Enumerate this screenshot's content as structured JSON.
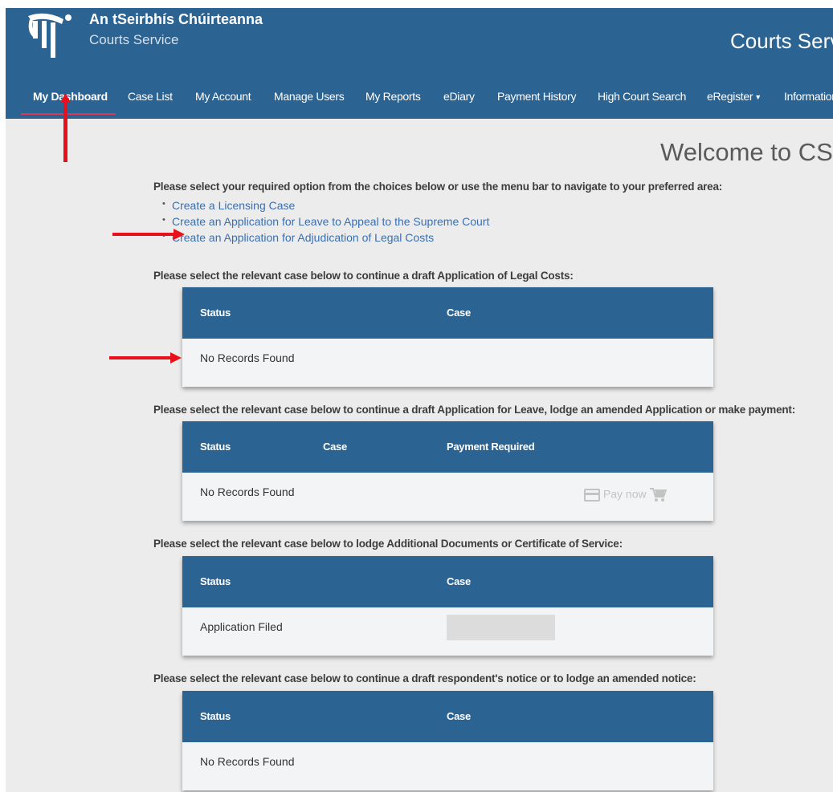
{
  "header": {
    "brand_title": "An tSeirbhís Chúirteanna",
    "brand_subtitle": "Courts Service",
    "right_title": "Courts Servi",
    "bg_color": "#2b6393",
    "logo_icon": "courts-harp-logo"
  },
  "nav": {
    "items": [
      {
        "label": "My Dashboard",
        "active": true
      },
      {
        "label": "Case List"
      },
      {
        "label": "My Account"
      },
      {
        "label": "Manage Users"
      },
      {
        "label": "My Reports"
      },
      {
        "label": "eDiary"
      },
      {
        "label": "Payment History"
      },
      {
        "label": "High Court Search"
      },
      {
        "label": "eRegister",
        "dropdown": true
      },
      {
        "label": "Information",
        "dropdown": true
      }
    ],
    "active_underline_color": "#d8385a"
  },
  "main": {
    "welcome": "Welcome to CSC",
    "intro": "Please select your required option from the choices below or use the menu bar to navigate to your preferred area:",
    "links": [
      "Create a Licensing Case",
      "Create an Application for Leave to Appeal to the Supreme Court",
      "Create an Application for Adjudication of Legal Costs"
    ],
    "sections": [
      {
        "label": "Please select the relevant case below to continue a draft Application of Legal Costs:",
        "headers": [
          "Status",
          "Case"
        ],
        "row": {
          "status": "No Records Found"
        }
      },
      {
        "label": "Please select the relevant case below to continue a draft Application for Leave, lodge an amended Application or make payment:",
        "headers": [
          "Status",
          "Case",
          "Payment Required"
        ],
        "row": {
          "status": "No Records Found",
          "pay_label": "Pay now"
        }
      },
      {
        "label": "Please select the relevant case below to lodge Additional Documents or Certificate of Service:",
        "headers": [
          "Status",
          "Case"
        ],
        "row": {
          "status": "Application Filed"
        }
      },
      {
        "label": "Please select the relevant case below to continue a draft respondent's notice or to lodge an amended notice:",
        "headers": [
          "Status",
          "Case"
        ],
        "row": {
          "status": "No Records Found"
        }
      }
    ]
  },
  "annotation_color": "#e8101a"
}
